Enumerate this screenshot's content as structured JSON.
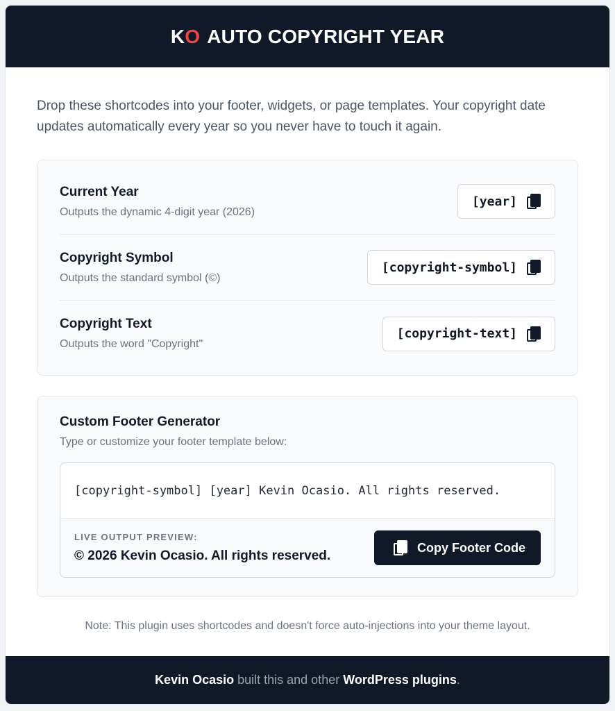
{
  "header": {
    "logo_k": "K",
    "logo_o": "O",
    "title": "AUTO COPYRIGHT YEAR"
  },
  "intro": "Drop these shortcodes into your footer, widgets, or page templates. Your copyright date updates automatically every year so you never have to touch it again.",
  "shortcodes": [
    {
      "title": "Current Year",
      "description": "Outputs the dynamic 4-digit year (2026)",
      "code": "[year]",
      "icon": "copy-icon"
    },
    {
      "title": "Copyright Symbol",
      "description": "Outputs the standard symbol (©)",
      "code": "[copyright-symbol]",
      "icon": "copy-icon"
    },
    {
      "title": "Copyright Text",
      "description": "Outputs the word \"Copyright\"",
      "code": "[copyright-text]",
      "icon": "copy-icon"
    }
  ],
  "generator": {
    "title": "Custom Footer Generator",
    "description": "Type or customize your footer template below:",
    "input_value": "[copyright-symbol] [year] Kevin Ocasio. All rights reserved.",
    "preview_label": "LIVE OUTPUT PREVIEW:",
    "preview_text": "© 2026 Kevin Ocasio. All rights reserved.",
    "button_label": "Copy Footer Code"
  },
  "note": "Note: This plugin uses shortcodes and doesn't force auto-injections into your theme layout.",
  "footer": {
    "author": "Kevin Ocasio",
    "middle": "built this and other",
    "link": "WordPress plugins",
    "end": "."
  },
  "colors": {
    "dark": "#111827",
    "accent_red": "#ef4444",
    "panel_bg": "#f8fafc",
    "muted_text": "#6b7280"
  }
}
